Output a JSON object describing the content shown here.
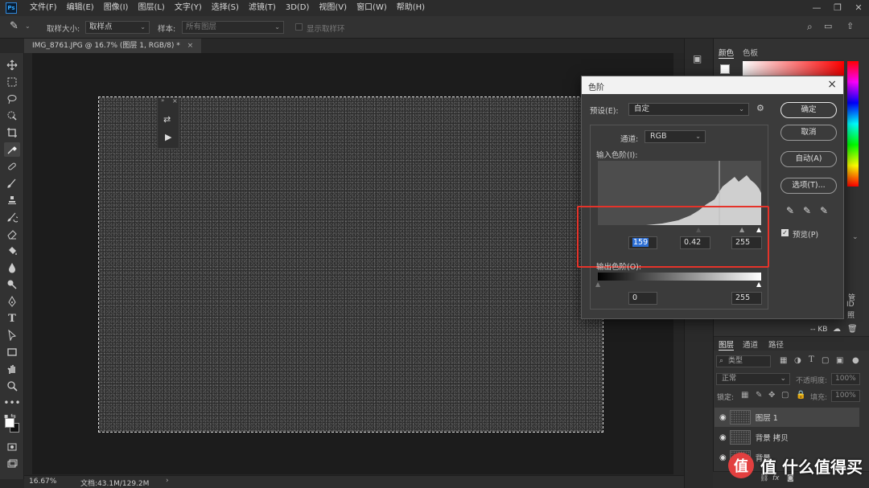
{
  "menu": {
    "logo": "Ps",
    "items": [
      "文件(F)",
      "编辑(E)",
      "图像(I)",
      "图层(L)",
      "文字(Y)",
      "选择(S)",
      "滤镜(T)",
      "3D(D)",
      "视图(V)",
      "窗口(W)",
      "帮助(H)"
    ]
  },
  "options": {
    "sample_size_label": "取样大小:",
    "sample_size_value": "取样点",
    "sample_label": "样本:",
    "sample_value": "所有图层",
    "show_ring_label": "显示取样环"
  },
  "document": {
    "tab_title": "IMG_8761.JPG @ 16.7% (图层 1, RGB/8) *"
  },
  "status": {
    "zoom": "16.67%",
    "doc_info": "文档:43.1M/129.2M"
  },
  "panels": {
    "color_tab": "颜色",
    "swatches_tab": "色板",
    "layers_tab": "图层",
    "channels_tab": "通道",
    "paths_tab": "路径",
    "kind_label": "类型",
    "blend_mode": "正常",
    "opacity_label": "不透明度:",
    "opacity_value": "100%",
    "lock_label": "锁定:",
    "fill_label": "填充:",
    "fill_value": "100%",
    "partial_text_1": "管",
    "partial_text_2": "ID",
    "partial_text_3": "照",
    "kb_label": "-- KB"
  },
  "layers": [
    {
      "name": "图层 1",
      "selected": true
    },
    {
      "name": "背景 拷贝",
      "selected": false
    },
    {
      "name": "背景",
      "selected": false
    }
  ],
  "watermark": "值 什么值得买",
  "levels": {
    "title": "色阶",
    "preset_label": "预设(E):",
    "preset_value": "自定",
    "channel_label": "通道:",
    "channel_value": "RGB",
    "input_label": "输入色阶(I):",
    "output_label": "输出色阶(O):",
    "input_black": "159",
    "input_gamma": "0.42",
    "input_white": "255",
    "output_black": "0",
    "output_white": "255",
    "buttons": {
      "ok": "确定",
      "cancel": "取消",
      "auto": "自动(A)",
      "options": "选项(T)..."
    },
    "preview_label": "预览(P)",
    "preview_checked": true
  }
}
